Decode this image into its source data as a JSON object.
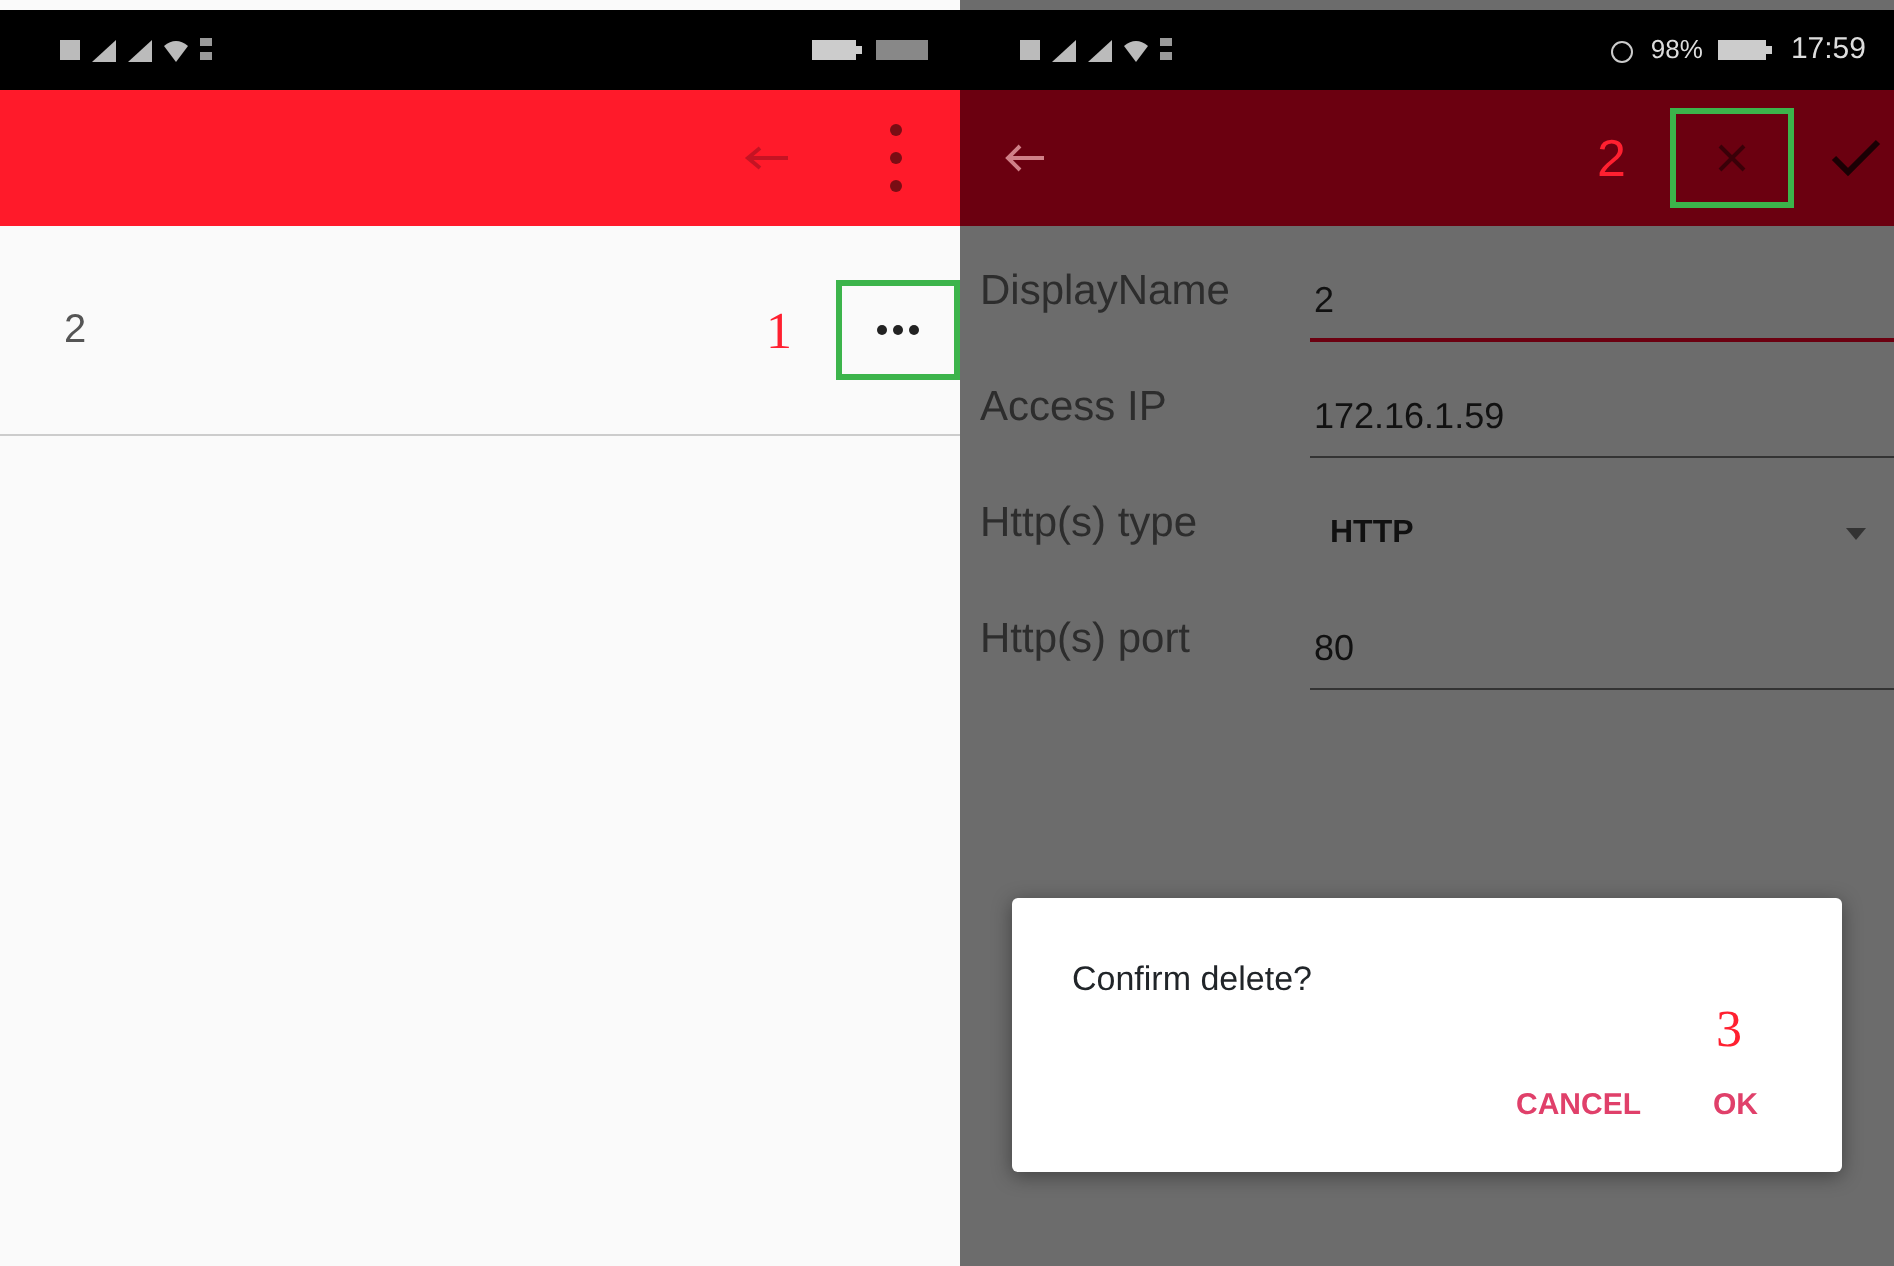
{
  "left_screen": {
    "list": [
      {
        "label": "2",
        "annotation": "1"
      }
    ]
  },
  "right_screen": {
    "status_bar": {
      "battery": "98%",
      "time": "17:59"
    },
    "toolbar": {
      "annotation": "2"
    },
    "form": [
      {
        "kind": "text",
        "label": "DisplayName",
        "value": "2",
        "focused": true
      },
      {
        "kind": "text",
        "label": "Access IP",
        "value": "172.16.1.59",
        "focused": false
      },
      {
        "kind": "select",
        "label": "Http(s) type",
        "value": "HTTP",
        "focused": false
      },
      {
        "kind": "text",
        "label": "Http(s) port",
        "value": "80",
        "focused": false
      }
    ],
    "dialog": {
      "message": "Confirm delete?",
      "annotation": "3",
      "buttons": [
        "CANCEL",
        "OK"
      ]
    }
  }
}
